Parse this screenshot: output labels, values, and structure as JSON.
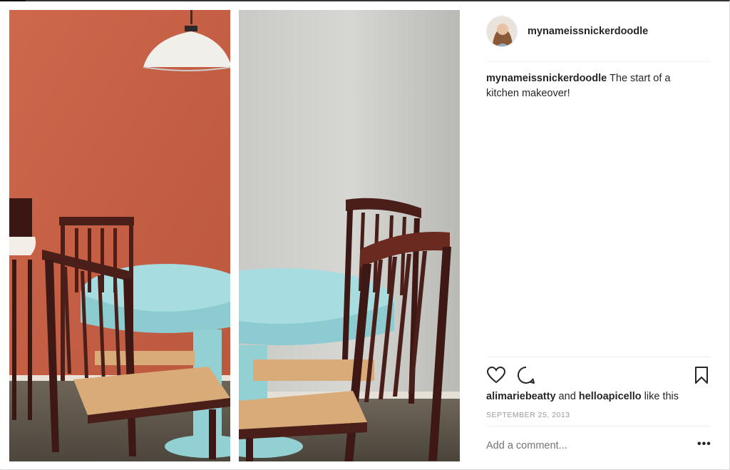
{
  "post": {
    "username": "mynameissnickerdoodle",
    "caption_user": "mynameissnickerdoodle",
    "caption_text": " The start of a kitchen makeover!",
    "likes": {
      "user1": "alimariebeatty",
      "and_text": " and ",
      "user2": "helloapicello",
      "suffix": " like this"
    },
    "date": "SEPTEMBER 25, 2013",
    "comment_placeholder": "Add a comment...",
    "more_label": "•••"
  },
  "icons": {
    "like": "heart-icon",
    "comment": "comment-bubble-icon",
    "save": "bookmark-icon",
    "more": "more-options-icon"
  },
  "colors": {
    "wall_left": "#c96348",
    "wall_right": "#cfd0cc",
    "table": "#a7dde0",
    "chair_wood": "#4a1f1a",
    "seat": "#d9ab79"
  }
}
